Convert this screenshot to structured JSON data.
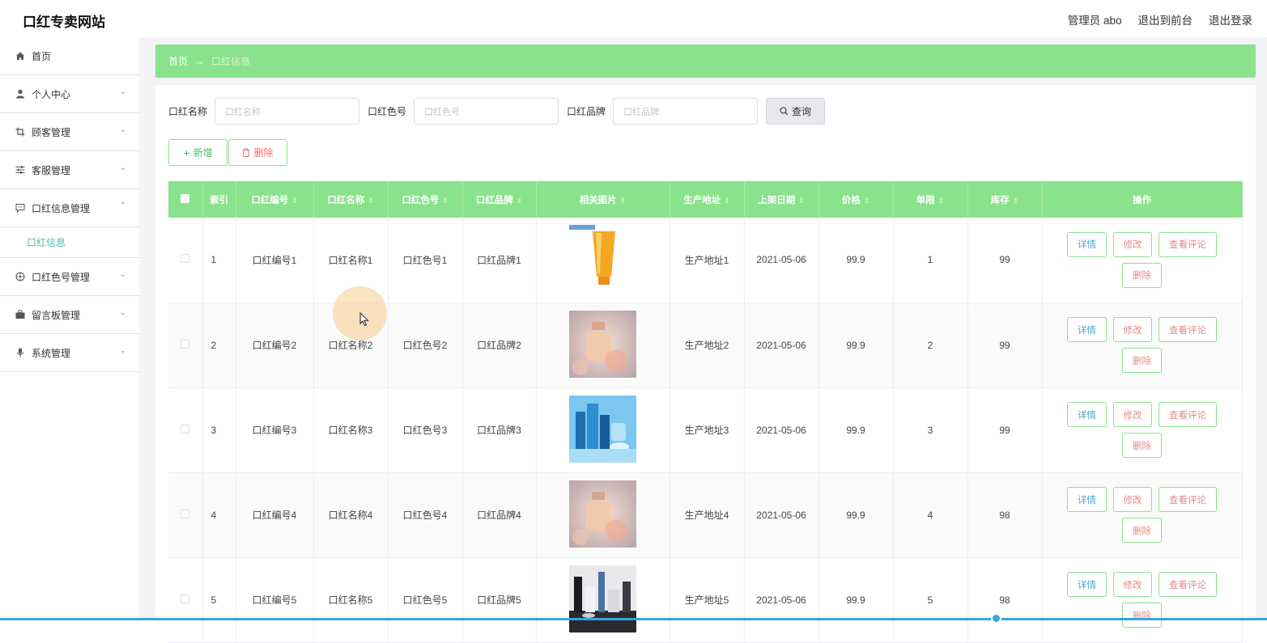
{
  "header": {
    "site_title": "口红专卖网站",
    "admin": "管理员 abo",
    "to_front": "退出到前台",
    "logout": "退出登录"
  },
  "sidebar": {
    "items": [
      {
        "label": "首页",
        "icon": "home-icon"
      },
      {
        "label": "个人中心",
        "icon": "user-icon"
      },
      {
        "label": "顾客管理",
        "icon": "crop-icon"
      },
      {
        "label": "客服管理",
        "icon": "sliders-icon"
      },
      {
        "label": "口红信息管理",
        "icon": "chat-icon"
      },
      {
        "label": "口红色号管理",
        "icon": "compass-icon"
      },
      {
        "label": "留言板管理",
        "icon": "briefcase-icon"
      },
      {
        "label": "系统管理",
        "icon": "mic-icon"
      }
    ],
    "sub_item": "口红信息"
  },
  "breadcrumb": {
    "home": "首页",
    "arrow": "→",
    "current": "口红信息"
  },
  "search": {
    "name_label": "口红名称",
    "name_placeholder": "口红名称",
    "color_label": "口红色号",
    "color_placeholder": "口红色号",
    "brand_label": "口红品牌",
    "brand_placeholder": "口红品牌",
    "query": "查询"
  },
  "actions": {
    "add": "新增",
    "delete": "删除"
  },
  "table": {
    "headers": [
      "索引",
      "口红编号",
      "口红名称",
      "口红色号",
      "口红品牌",
      "相关图片",
      "生产地址",
      "上架日期",
      "价格",
      "单限",
      "库存",
      "操作"
    ],
    "op_labels": {
      "detail": "详情",
      "edit": "修改",
      "review": "查看评论",
      "delete": "删除"
    },
    "rows": [
      {
        "idx": "1",
        "code": "口红编号1",
        "name": "口红名称1",
        "color": "口红色号1",
        "brand": "口红品牌1",
        "image": "orange-tube",
        "address": "生产地址1",
        "date": "2021-05-06",
        "price": "99.9",
        "limit": "1",
        "stock": "99"
      },
      {
        "idx": "2",
        "code": "口红编号2",
        "name": "口红名称2",
        "color": "口红色号2",
        "brand": "口红品牌2",
        "image": "perfume-pink",
        "address": "生产地址2",
        "date": "2021-05-06",
        "price": "99.9",
        "limit": "2",
        "stock": "99"
      },
      {
        "idx": "3",
        "code": "口红编号3",
        "name": "口红名称3",
        "color": "口红色号3",
        "brand": "口红品牌3",
        "image": "blue-bottles",
        "address": "生产地址3",
        "date": "2021-05-06",
        "price": "99.9",
        "limit": "3",
        "stock": "99"
      },
      {
        "idx": "4",
        "code": "口红编号4",
        "name": "口红名称4",
        "color": "口红色号4",
        "brand": "口红品牌4",
        "image": "perfume-pink",
        "address": "生产地址4",
        "date": "2021-05-06",
        "price": "99.9",
        "limit": "4",
        "stock": "98"
      },
      {
        "idx": "5",
        "code": "口红编号5",
        "name": "口红名称5",
        "color": "口红色号5",
        "brand": "口红品牌5",
        "image": "dark-cosmetics",
        "address": "生产地址5",
        "date": "2021-05-06",
        "price": "99.9",
        "limit": "5",
        "stock": "98"
      }
    ]
  },
  "colors": {
    "accent": "#8ae28c",
    "danger": "#f56c6c",
    "info": "#49a8c9"
  }
}
